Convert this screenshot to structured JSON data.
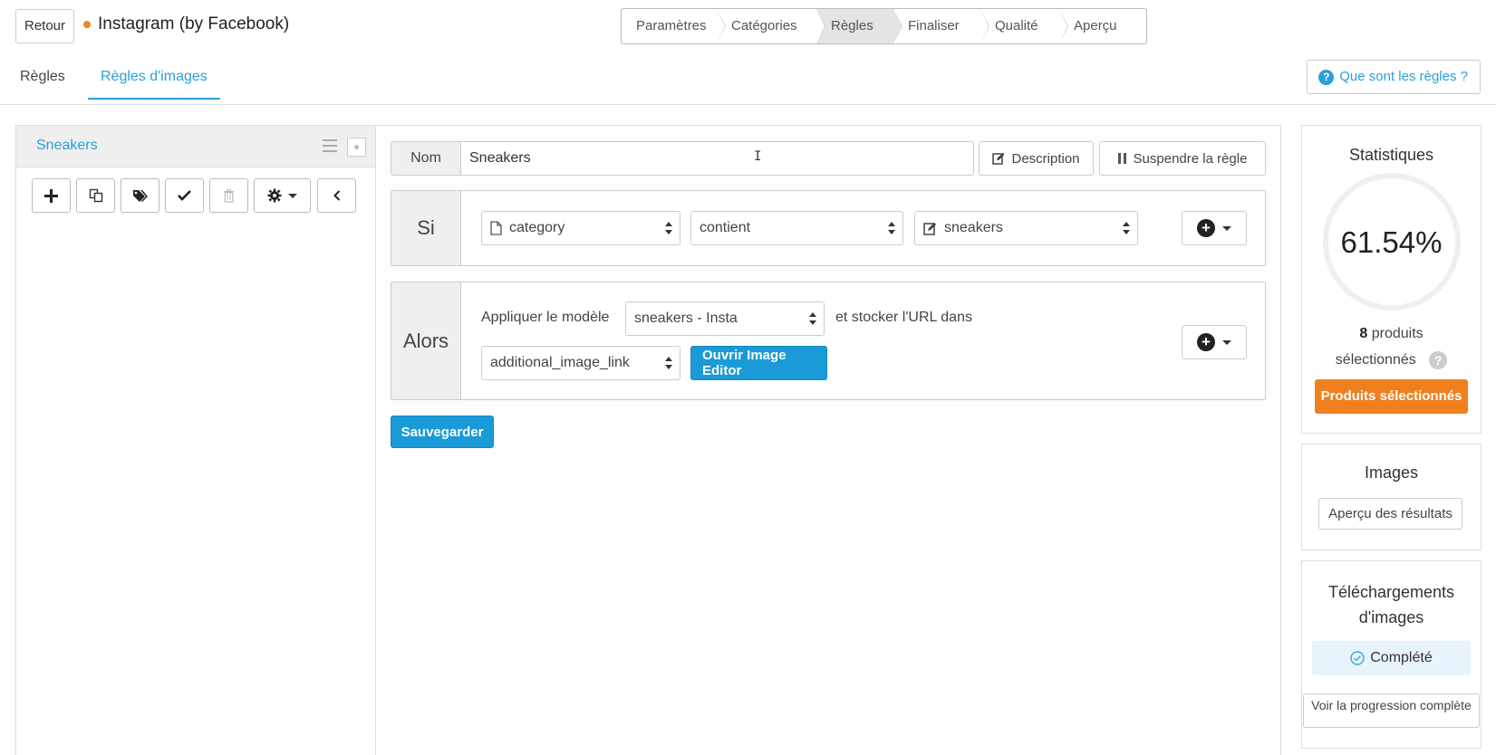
{
  "header": {
    "back_label": "Retour",
    "app_title": "Instagram (by Facebook)",
    "status_color": "#f0871f"
  },
  "wizard": {
    "steps": [
      "Paramètres",
      "Catégories",
      "Règles",
      "Finaliser",
      "Qualité",
      "Aperçu"
    ],
    "active": "Règles"
  },
  "subnav": {
    "tabs": [
      "Règles",
      "Règles d'images"
    ],
    "active": "Règles d'images",
    "help_label": "Que sont les règles ?"
  },
  "rules_list": {
    "items": [
      {
        "label": "Sneakers"
      }
    ]
  },
  "rule": {
    "name_label": "Nom",
    "name_value": "Sneakers",
    "description_label": "Description",
    "suspend_label": "Suspendre la règle",
    "if_label": "Si",
    "condition": {
      "field": "category",
      "operator": "contient",
      "value": "sneakers"
    },
    "then_label": "Alors",
    "action": {
      "apply_text": "Appliquer le modèle",
      "template": "sneakers - Insta",
      "store_text": "et stocker l'URL dans",
      "target_field": "additional_image_link",
      "open_editor_label": "Ouvrir Image Editor"
    },
    "save_label": "Sauvegarder"
  },
  "stats": {
    "title": "Statistiques",
    "percent": 61.54,
    "percent_text": "61.54%",
    "selected_count": "8",
    "selected_text_1": "produits",
    "selected_text_2": "sélectionnés",
    "selected_button": "Produits sélectionnés",
    "accent_color": "#f0801e"
  },
  "images": {
    "title": "Images",
    "preview_button": "Aperçu des résultats"
  },
  "downloads": {
    "title": "Téléchargements d'images",
    "status": "Complété",
    "progress_button": "Voir la progression complète"
  }
}
